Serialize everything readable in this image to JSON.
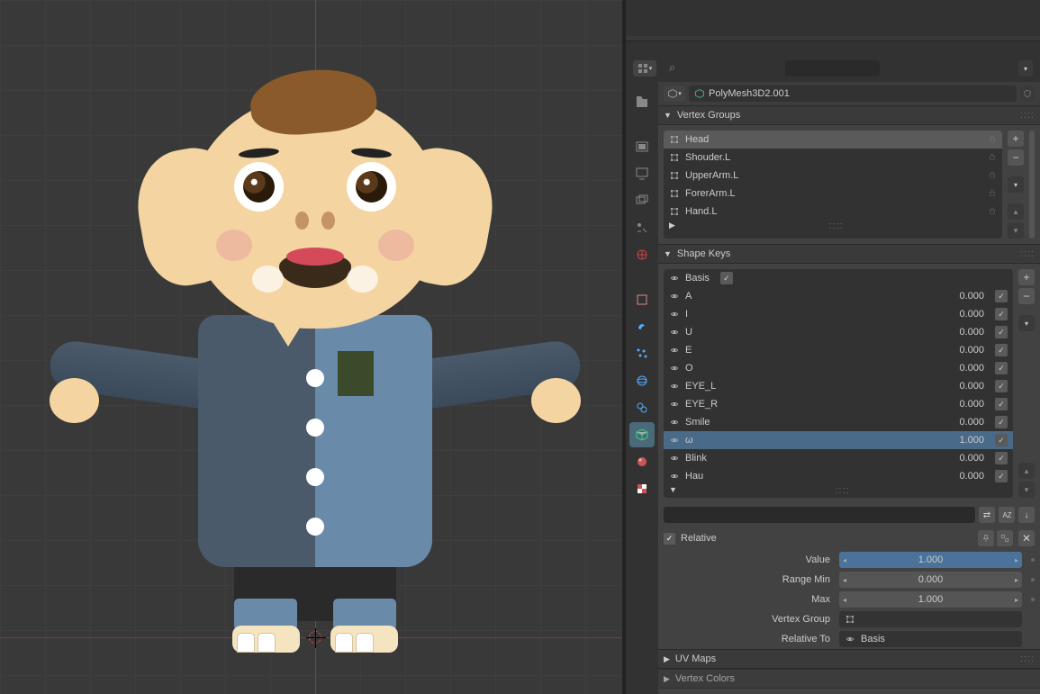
{
  "object_name": "PolyMesh3D2.001",
  "search": {
    "placeholder": ""
  },
  "panels": {
    "vertex_groups": {
      "title": "Vertex Groups"
    },
    "shape_keys": {
      "title": "Shape Keys"
    },
    "uv_maps": {
      "title": "UV Maps"
    },
    "vertex_colors": {
      "title": "Vertex Colors"
    }
  },
  "vertex_groups": [
    {
      "name": "Head",
      "selected": true
    },
    {
      "name": "Shouder.L"
    },
    {
      "name": "UpperArm.L"
    },
    {
      "name": "ForerArm.L"
    },
    {
      "name": "Hand.L"
    }
  ],
  "shape_keys": [
    {
      "name": "Basis",
      "value": null,
      "enabled": true
    },
    {
      "name": "A",
      "value": "0.000",
      "enabled": true
    },
    {
      "name": "I",
      "value": "0.000",
      "enabled": true
    },
    {
      "name": "U",
      "value": "0.000",
      "enabled": true
    },
    {
      "name": "E",
      "value": "0.000",
      "enabled": true
    },
    {
      "name": "O",
      "value": "0.000",
      "enabled": true
    },
    {
      "name": "EYE_L",
      "value": "0.000",
      "enabled": true
    },
    {
      "name": "EYE_R",
      "value": "0.000",
      "enabled": true
    },
    {
      "name": "Smile",
      "value": "0.000",
      "enabled": true
    },
    {
      "name": "ω",
      "value": "1.000",
      "enabled": true,
      "active": true
    },
    {
      "name": "Blink",
      "value": "0.000",
      "enabled": true
    },
    {
      "name": "Hau",
      "value": "0.000",
      "enabled": true
    }
  ],
  "relative": {
    "label": "Relative",
    "checked": true
  },
  "fields": {
    "value": {
      "label": "Value",
      "val": "1.000"
    },
    "range_min": {
      "label": "Range Min",
      "val": "0.000"
    },
    "max": {
      "label": "Max",
      "val": "1.000"
    },
    "vertex_group": {
      "label": "Vertex Group",
      "val": ""
    },
    "relative_to": {
      "label": "Relative To",
      "val": "Basis"
    }
  },
  "sort_label": "A Z"
}
